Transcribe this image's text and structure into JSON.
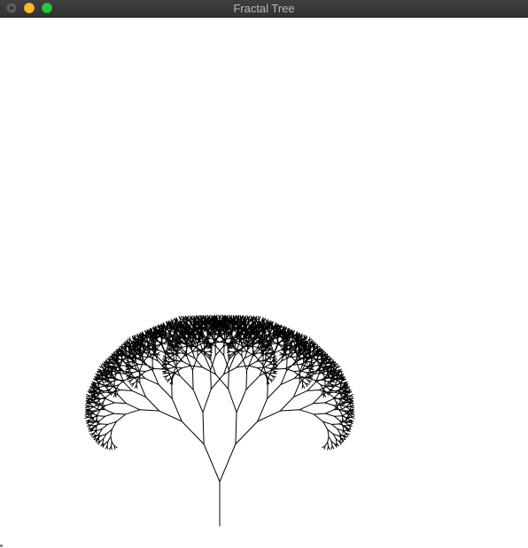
{
  "window": {
    "title": "Fractal Tree",
    "controls": {
      "close": "close-icon",
      "minimize": "minimize-icon",
      "zoom": "zoom-icon"
    }
  },
  "canvas": {
    "background": "#ffffff",
    "stroke_color": "#000000",
    "content": "fractal-tree"
  },
  "colors": {
    "titlebar": "#383838",
    "title_text": "#b8b8b8",
    "close": "#5f5f5f",
    "minimize": "#ffbd2e",
    "zoom": "#28c941"
  }
}
